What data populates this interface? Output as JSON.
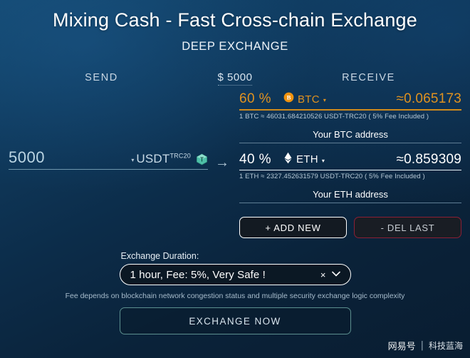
{
  "header": {
    "title": "Mixing Cash - Fast Cross-chain Exchange",
    "subtitle": "DEEP EXCHANGE"
  },
  "columns": {
    "send_label": "SEND",
    "amount_label": "$ 5000",
    "receive_label": "RECEIVE"
  },
  "send": {
    "amount": "5000",
    "token_caret": "▾",
    "token_name": "USDT",
    "token_network": "TRC20",
    "token_icon": "usdt-token-icon",
    "arrow_icon": "→"
  },
  "receive": [
    {
      "percent": "60 %",
      "coin_icon": "btc-icon",
      "coin_name": "BTC",
      "caret": "▾",
      "approx_amount": "≈0.065173",
      "rate_text": "1 BTC ≈ 46031.684210526 USDT-TRC20 ( 5% Fee Included )",
      "address_placeholder": "Your BTC address",
      "accent": "#e0921f"
    },
    {
      "percent": "40 %",
      "coin_icon": "eth-icon",
      "coin_name": "ETH",
      "caret": "▾",
      "approx_amount": "≈0.859309",
      "rate_text": "1 ETH ≈ 2327.452631579 USDT-TRC20 ( 5% Fee Included )",
      "address_placeholder": "Your ETH address",
      "accent": "#ffffff"
    }
  ],
  "buttons": {
    "add_new": "+ ADD NEW",
    "del_last": "- DEL LAST"
  },
  "duration": {
    "label": "Exchange Duration:",
    "selected": "1 hour, Fee: 5%, Very Safe !",
    "clear_icon": "×",
    "chevron_icon": "⌄"
  },
  "fee_note": "Fee depends on blockchain network congestion status and multiple security exchange logic complexity",
  "exchange_button": "EXCHANGE NOW",
  "watermark": {
    "brand": "网易号",
    "separator": "|",
    "channel": "科技蓝海"
  },
  "colors": {
    "btc_orange": "#e0921f",
    "white": "#ffffff",
    "del_red_border": "#8c1f35",
    "exchange_border": "#5c8f8f"
  }
}
